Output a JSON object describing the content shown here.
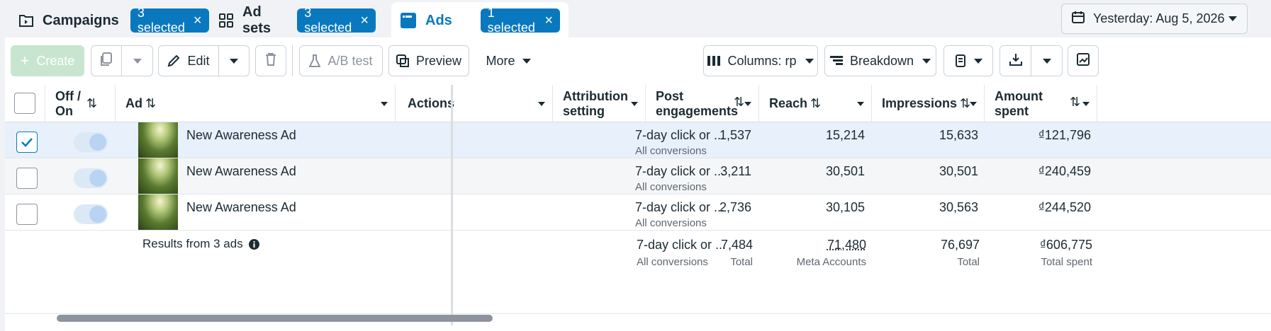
{
  "tabs": {
    "campaigns": {
      "label": "Campaigns",
      "badge": "3 selected",
      "icon": "folder-icon"
    },
    "adsets": {
      "label": "Ad sets",
      "badge": "3 selected",
      "icon": "grid-icon"
    },
    "ads": {
      "label": "Ads",
      "badge": "1 selected",
      "icon": "ad-window-icon"
    }
  },
  "date_range": {
    "label": "Yesterday: Aug 5, 2026",
    "icon": "calendar-icon"
  },
  "toolbar": {
    "create": "Create",
    "edit": "Edit",
    "ab_test": "A/B test",
    "preview": "Preview",
    "more": "More",
    "columns": "Columns: rp",
    "breakdown": "Breakdown"
  },
  "columns": {
    "off_on_1": "Off /",
    "off_on_2": "On",
    "ad": "Ad",
    "actions": "Actions",
    "attribution_1": "Attribution",
    "attribution_2": "setting",
    "post_eng_1": "Post",
    "post_eng_2": "engagements",
    "reach": "Reach",
    "impressions": "Impressions",
    "amount_1": "Amount",
    "amount_2": "spent"
  },
  "rows": [
    {
      "name": "New Awareness Ad",
      "attribution": "7-day click or ...",
      "attribution_sub": "All conversions",
      "post_engagements": "1,537",
      "reach": "15,214",
      "impressions": "15,633",
      "amount_spent": "₫121,796",
      "checked": true
    },
    {
      "name": "New Awareness Ad",
      "attribution": "7-day click or ...",
      "attribution_sub": "All conversions",
      "post_engagements": "3,211",
      "reach": "30,501",
      "impressions": "30,501",
      "amount_spent": "₫240,459",
      "checked": false
    },
    {
      "name": "New Awareness Ad",
      "attribution": "7-day click or ...",
      "attribution_sub": "All conversions",
      "post_engagements": "2,736",
      "reach": "30,105",
      "impressions": "30,563",
      "amount_spent": "₫244,520",
      "checked": false
    }
  ],
  "totals": {
    "label": "Results from 3 ads",
    "attribution": "7-day click or ...",
    "attribution_sub": "All conversions",
    "post_engagements": "7,484",
    "post_engagements_sub": "Total",
    "reach": "71,480",
    "reach_sub": "Meta Accounts",
    "impressions": "76,697",
    "impressions_sub": "Total",
    "amount_spent": "₫606,775",
    "amount_spent_sub": "Total spent"
  },
  "colors": {
    "accent": "#0a78be",
    "create": "#c8e6cf",
    "selected_row": "#e7f0fb"
  }
}
